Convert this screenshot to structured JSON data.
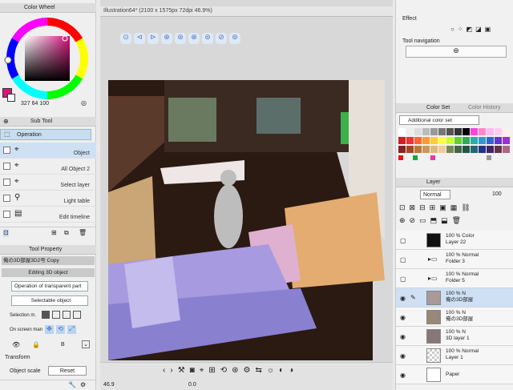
{
  "colors": {
    "main": "#d6147c",
    "accent": "#3a8ee6",
    "selected": "#cfe0f5"
  },
  "color_wheel": {
    "title": "Color Wheel",
    "readout": "327  64  100"
  },
  "sub_tool": {
    "title": "Sub Tool",
    "group": "Operation",
    "items": [
      {
        "label": "Object",
        "checked": true
      },
      {
        "label": "All Object 2",
        "checked": false
      },
      {
        "label": "Select layer",
        "checked": false
      },
      {
        "label": "Light table",
        "checked": false
      },
      {
        "label": "Edit timeline",
        "checked": false
      }
    ]
  },
  "tool_property": {
    "title": "Tool Property",
    "object_name": "俺の3D部屋3D2号 Copy",
    "mode": "Editing 3D object",
    "transparent": "Operation of transparent part",
    "selectable": "Selectable object",
    "selection_mode": "Selection m.",
    "onscreen": "On screen man",
    "transform": "Transform",
    "object_scale": "Object scale",
    "reset": "Reset"
  },
  "canvas": {
    "tab": "Illustration64* (2100 x 1575px 72dpi 46.9%)",
    "zoom": "46.9",
    "value": "0.0"
  },
  "effect": {
    "title": "Effect",
    "tool_navigation": "Tool navigation"
  },
  "color_set": {
    "tabs": [
      "Color Set",
      "Color History"
    ],
    "set_name": "Additional color set"
  },
  "layer_panel": {
    "title": "Layer",
    "blend": "Normal",
    "opacity": "100",
    "layers": [
      {
        "line1": "100 % Color",
        "line2": "Layer 22",
        "type": "color",
        "selected": false
      },
      {
        "line1": "100 % Normal",
        "line2": "Folder 3",
        "type": "folder",
        "selected": false
      },
      {
        "line1": "100 % Normal",
        "line2": "Folder 5",
        "type": "folder",
        "selected": false
      },
      {
        "line1": "100 % N",
        "line2": "俺の3D部屋",
        "type": "3d",
        "selected": true
      },
      {
        "line1": "100 % N",
        "line2": "俺の3D部屋",
        "type": "3d",
        "selected": false
      },
      {
        "line1": "100 % N",
        "line2": "3D layer 1",
        "type": "3d",
        "selected": false
      },
      {
        "line1": "100 % Normal",
        "line2": "Layer 1",
        "type": "raster",
        "selected": false
      },
      {
        "line1": "Paper",
        "line2": "",
        "type": "paper",
        "selected": false
      }
    ]
  }
}
